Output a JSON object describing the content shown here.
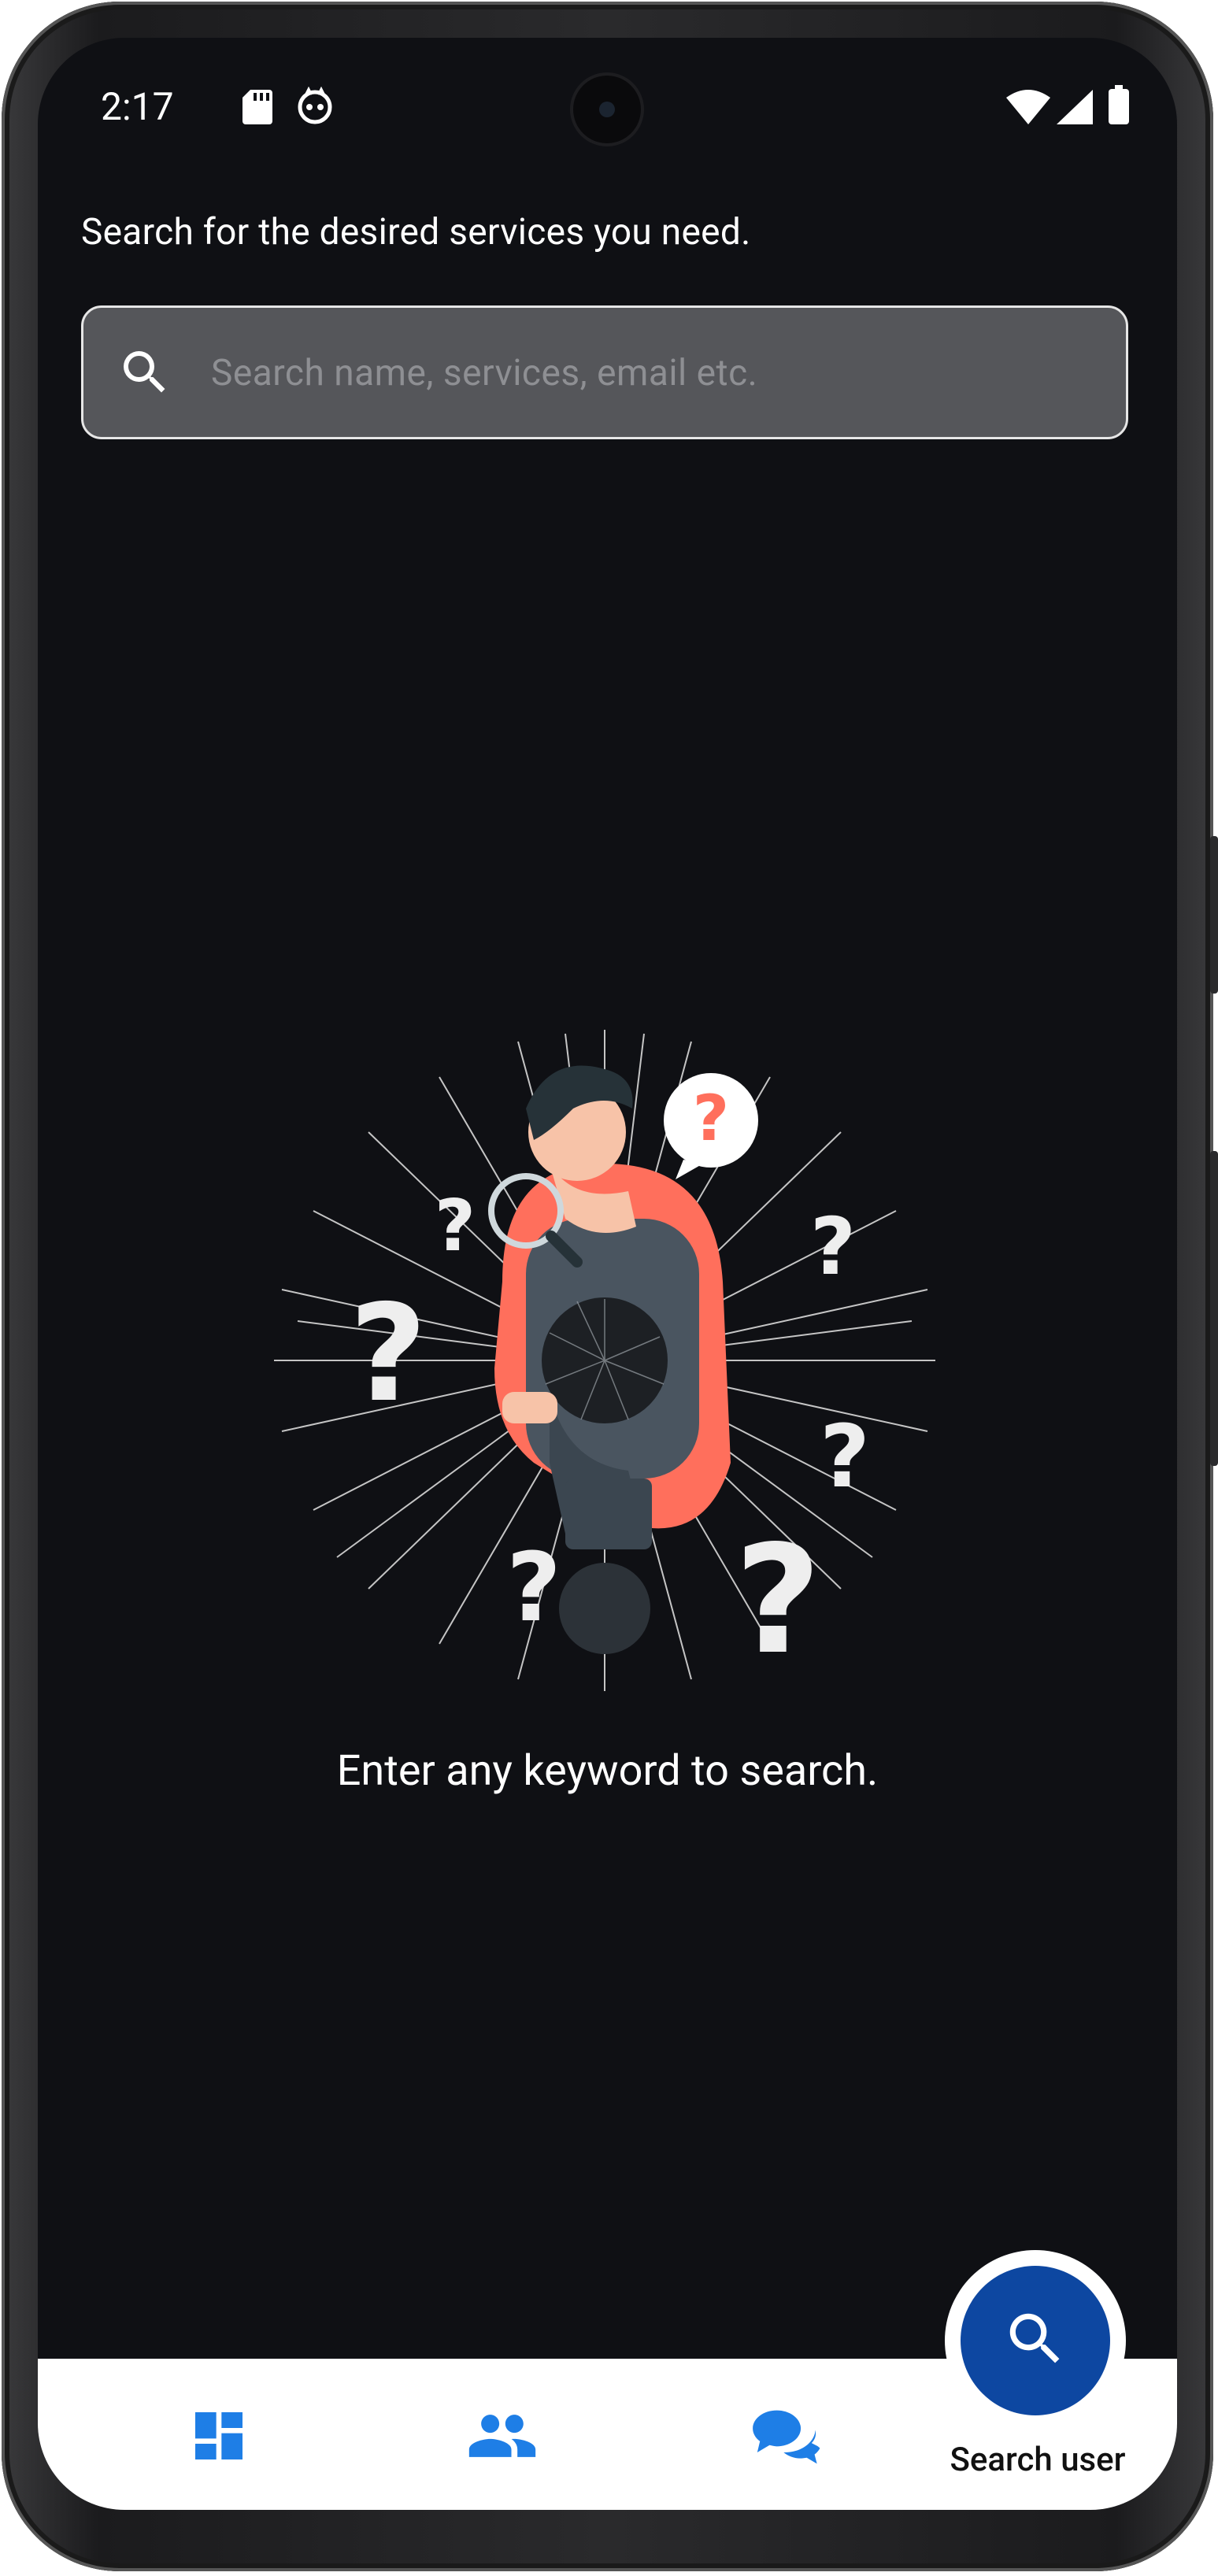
{
  "status_bar": {
    "time": "2:17",
    "icons": [
      "sd-card-icon",
      "app-notification-icon",
      "wifi-icon",
      "cellular-signal-icon",
      "battery-icon"
    ]
  },
  "search": {
    "prompt": "Search for the desired services you need.",
    "placeholder": "Search name, services, email etc.",
    "value": ""
  },
  "empty_state": {
    "message": "Enter any keyword to search.",
    "illustration": "man-with-magnifier-question-marks"
  },
  "bottom_nav": {
    "items": [
      {
        "icon": "dashboard-icon",
        "label": ""
      },
      {
        "icon": "users-icon",
        "label": ""
      },
      {
        "icon": "chat-icon",
        "label": ""
      }
    ],
    "fab": {
      "icon": "search-icon",
      "label": "Search user"
    }
  },
  "colors": {
    "background": "#0f1014",
    "search_box": "#55565a",
    "accent_blue": "#1e7ee6",
    "fab_blue": "#0d47a1",
    "illustration_coral": "#ff6f5c"
  }
}
